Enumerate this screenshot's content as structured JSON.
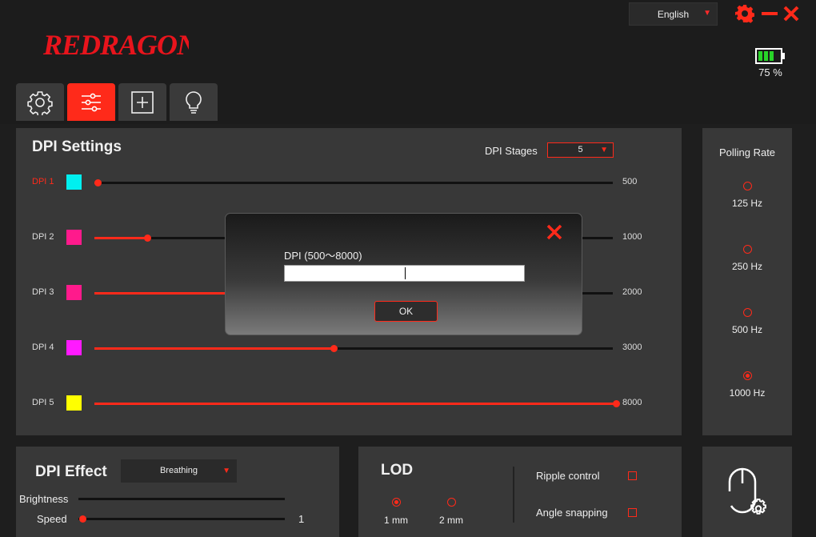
{
  "app": {
    "logo_text": "REDRAGON"
  },
  "header": {
    "language": "English",
    "battery_percent": "75 %",
    "battery_level": 0.75
  },
  "tabs": [
    {
      "icon": "gear-icon",
      "active": false
    },
    {
      "icon": "sliders-icon",
      "active": true
    },
    {
      "icon": "plus-box-icon",
      "active": false
    },
    {
      "icon": "bulb-icon",
      "active": false
    }
  ],
  "dpi_settings": {
    "title": "DPI Settings",
    "stages_label": "DPI Stages",
    "stages_value": "5",
    "rows": [
      {
        "label": "DPI 1",
        "color": "#00f0f0",
        "value": "500",
        "fraction": 0.0,
        "active": true
      },
      {
        "label": "DPI 2",
        "color": "#ff1a8c",
        "value": "1000",
        "fraction": 0.095,
        "active": false
      },
      {
        "label": "DPI 3",
        "color": "#ff1a8c",
        "value": "2000",
        "fraction": 0.32,
        "active": false
      },
      {
        "label": "DPI 4",
        "color": "#ff1aff",
        "value": "3000",
        "fraction": 0.455,
        "active": false
      },
      {
        "label": "DPI 5",
        "color": "#ffff00",
        "value": "8000",
        "fraction": 1.0,
        "active": false
      }
    ]
  },
  "polling_rate": {
    "title": "Polling Rate",
    "options": [
      {
        "label": "125 Hz",
        "selected": false
      },
      {
        "label": "250 Hz",
        "selected": false
      },
      {
        "label": "500 Hz",
        "selected": false
      },
      {
        "label": "1000 Hz",
        "selected": true
      }
    ]
  },
  "dpi_effect": {
    "title": "DPI Effect",
    "mode": "Breathing",
    "brightness_label": "Brightness",
    "speed_label": "Speed",
    "speed_value": "1"
  },
  "lod": {
    "title": "LOD",
    "options": [
      {
        "label": "1 mm",
        "selected": true
      },
      {
        "label": "2 mm",
        "selected": false
      }
    ],
    "ripple_label": "Ripple control",
    "angle_label": "Angle snapping"
  },
  "dialog": {
    "label": "DPI  (500～8000)",
    "input_value": "",
    "ok_label": "OK"
  },
  "colors": {
    "accent": "#ff2a1a",
    "panel": "#383838",
    "background": "#1e1e1e"
  }
}
